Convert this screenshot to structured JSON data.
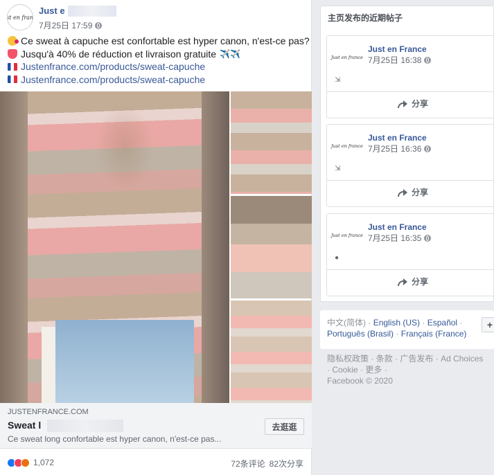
{
  "post": {
    "page_name": "Just e",
    "timestamp": "7月25日 17:59",
    "avatar_logo": "Just en france",
    "text_lines": [
      "Ce sweat à capuche est confortable est hyper canon, n'est-ce pas?",
      "Jusqu'à 40% de réduction et livraison gratuite",
      "Justenfrance.com/products/sweat-capuche",
      "Justenfrance.com/products/sweat-capuche"
    ],
    "plane_emoji": "✈️✈️",
    "link_preview": {
      "domain": "JUSTENFRANCE.COM",
      "title": "Sweat l",
      "description": "Ce sweat long confortable est hyper canon, n'est-ce pas...",
      "button_label": "去逛逛"
    },
    "reaction_count": "1,072",
    "comments": "72条评论",
    "shares": "82次分享"
  },
  "recent_posts": {
    "title": "主页发布的近期帖子",
    "items": [
      {
        "name": "Just en France",
        "time": "7月25日 16:38",
        "share_label": "分享",
        "icon": "link-icon"
      },
      {
        "name": "Just en France",
        "time": "7月25日 16:36",
        "share_label": "分享",
        "icon": "link-icon"
      },
      {
        "name": "Just en France",
        "time": "7月25日 16:35",
        "share_label": "分享",
        "icon": "tag-icon"
      }
    ]
  },
  "languages": {
    "current": "中文(简体)",
    "options": [
      "English (US)",
      "Español",
      "Português (Brasil)",
      "Français (France)"
    ],
    "plus_label": "+"
  },
  "footer": {
    "links": [
      "隐私权政策",
      "条款",
      "广告发布",
      "Ad Choices",
      "Cookie",
      "更多"
    ],
    "copyright": "Facebook © 2020"
  },
  "colors": {
    "link_blue": "#385898",
    "page_bg": "#e9ebee",
    "like_blue": "#1877f2",
    "love_red": "#f33e58",
    "angry_orange": "#e9710f"
  }
}
